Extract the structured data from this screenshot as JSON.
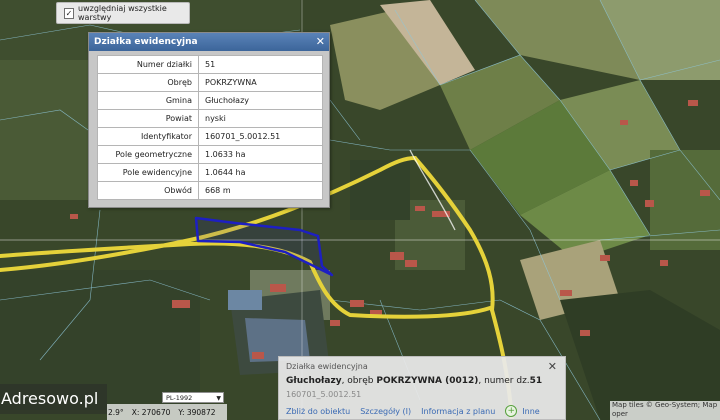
{
  "layers": {
    "toggle_label": "uwzględniaj wszystkie warstwy",
    "checked": true
  },
  "parcel_popup": {
    "title": "Działka ewidencyjna",
    "close": "✕",
    "rows": [
      {
        "label": "Numer działki",
        "value": "51"
      },
      {
        "label": "Obręb",
        "value": "POKRZYWNA"
      },
      {
        "label": "Gmina",
        "value": "Głuchołazy"
      },
      {
        "label": "Powiat",
        "value": "nyski"
      },
      {
        "label": "Identyfikator",
        "value": "160701_5.0012.51"
      },
      {
        "label": "Pole geometryczne",
        "value": "1.0633 ha"
      },
      {
        "label": "Pole ewidencyjne",
        "value": "1.0644 ha"
      },
      {
        "label": "Obwód",
        "value": "668 m"
      }
    ]
  },
  "info_panel": {
    "title": "Działka ewidencyjna",
    "close": "✕",
    "gmina": "Głuchołazy",
    "obreb_prefix": ", obręb ",
    "obreb": "POKRZYWNA (0012)",
    "numer_prefix": ", numer dz.",
    "numer": "51",
    "identyfikator": "160701_5.0012.51",
    "links": {
      "zoom": "Zbliż do obiektu",
      "details": "Szczegóły (I)",
      "plan": "Informacja z planu",
      "other": "Inne"
    }
  },
  "watermark": "Adresowo.pl",
  "coords": {
    "scale_fragment": "2.9°",
    "x": "X: 270670",
    "y": "Y: 390872",
    "crs": "PL-1992"
  },
  "attribution": "Map tiles © Geo-System; Map oper",
  "colors": {
    "road": "#e5d23a",
    "parcel": "#1d1fc2",
    "panel_header": "#4a72a8",
    "link": "#3a6ab4"
  }
}
